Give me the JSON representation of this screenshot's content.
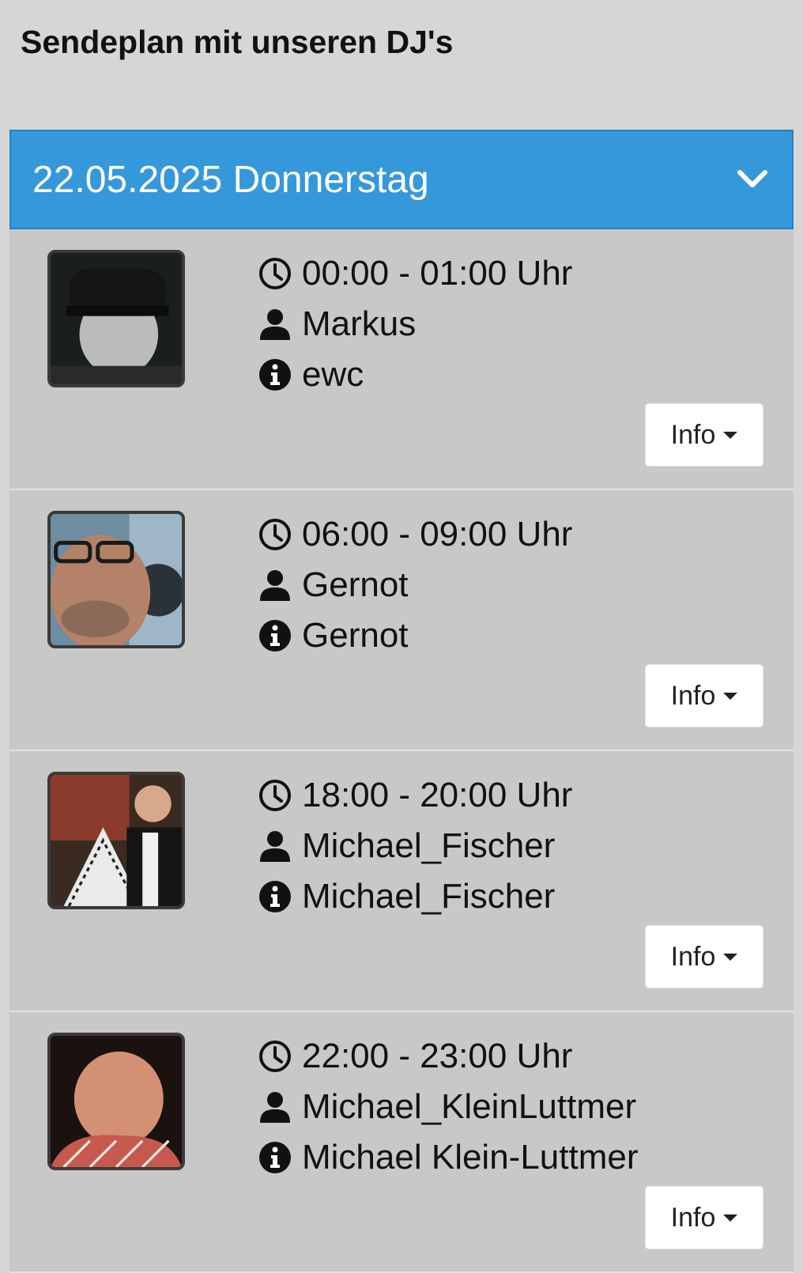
{
  "page": {
    "title": "Sendeplan mit unseren DJ's"
  },
  "day": {
    "label": "22.05.2025 Donnerstag",
    "expand_icon": "chevron-down-icon",
    "accent_color": "#3598db"
  },
  "schedule": [
    {
      "time": "00:00 - 01:00 Uhr",
      "dj": "Markus",
      "show": "ewc",
      "button": "Info",
      "avatar": "dj-photo-markus"
    },
    {
      "time": "06:00 - 09:00 Uhr",
      "dj": "Gernot",
      "show": "Gernot",
      "button": "Info",
      "avatar": "dj-photo-gernot"
    },
    {
      "time": "18:00 - 20:00 Uhr",
      "dj": "Michael_Fischer",
      "show": "Michael_Fischer",
      "button": "Info",
      "avatar": "dj-photo-michael-fischer"
    },
    {
      "time": "22:00 - 23:00 Uhr",
      "dj": "Michael_KleinLuttmer",
      "show": "Michael Klein-Luttmer",
      "button": "Info",
      "avatar": "dj-photo-michael-kleinluttmer"
    }
  ]
}
